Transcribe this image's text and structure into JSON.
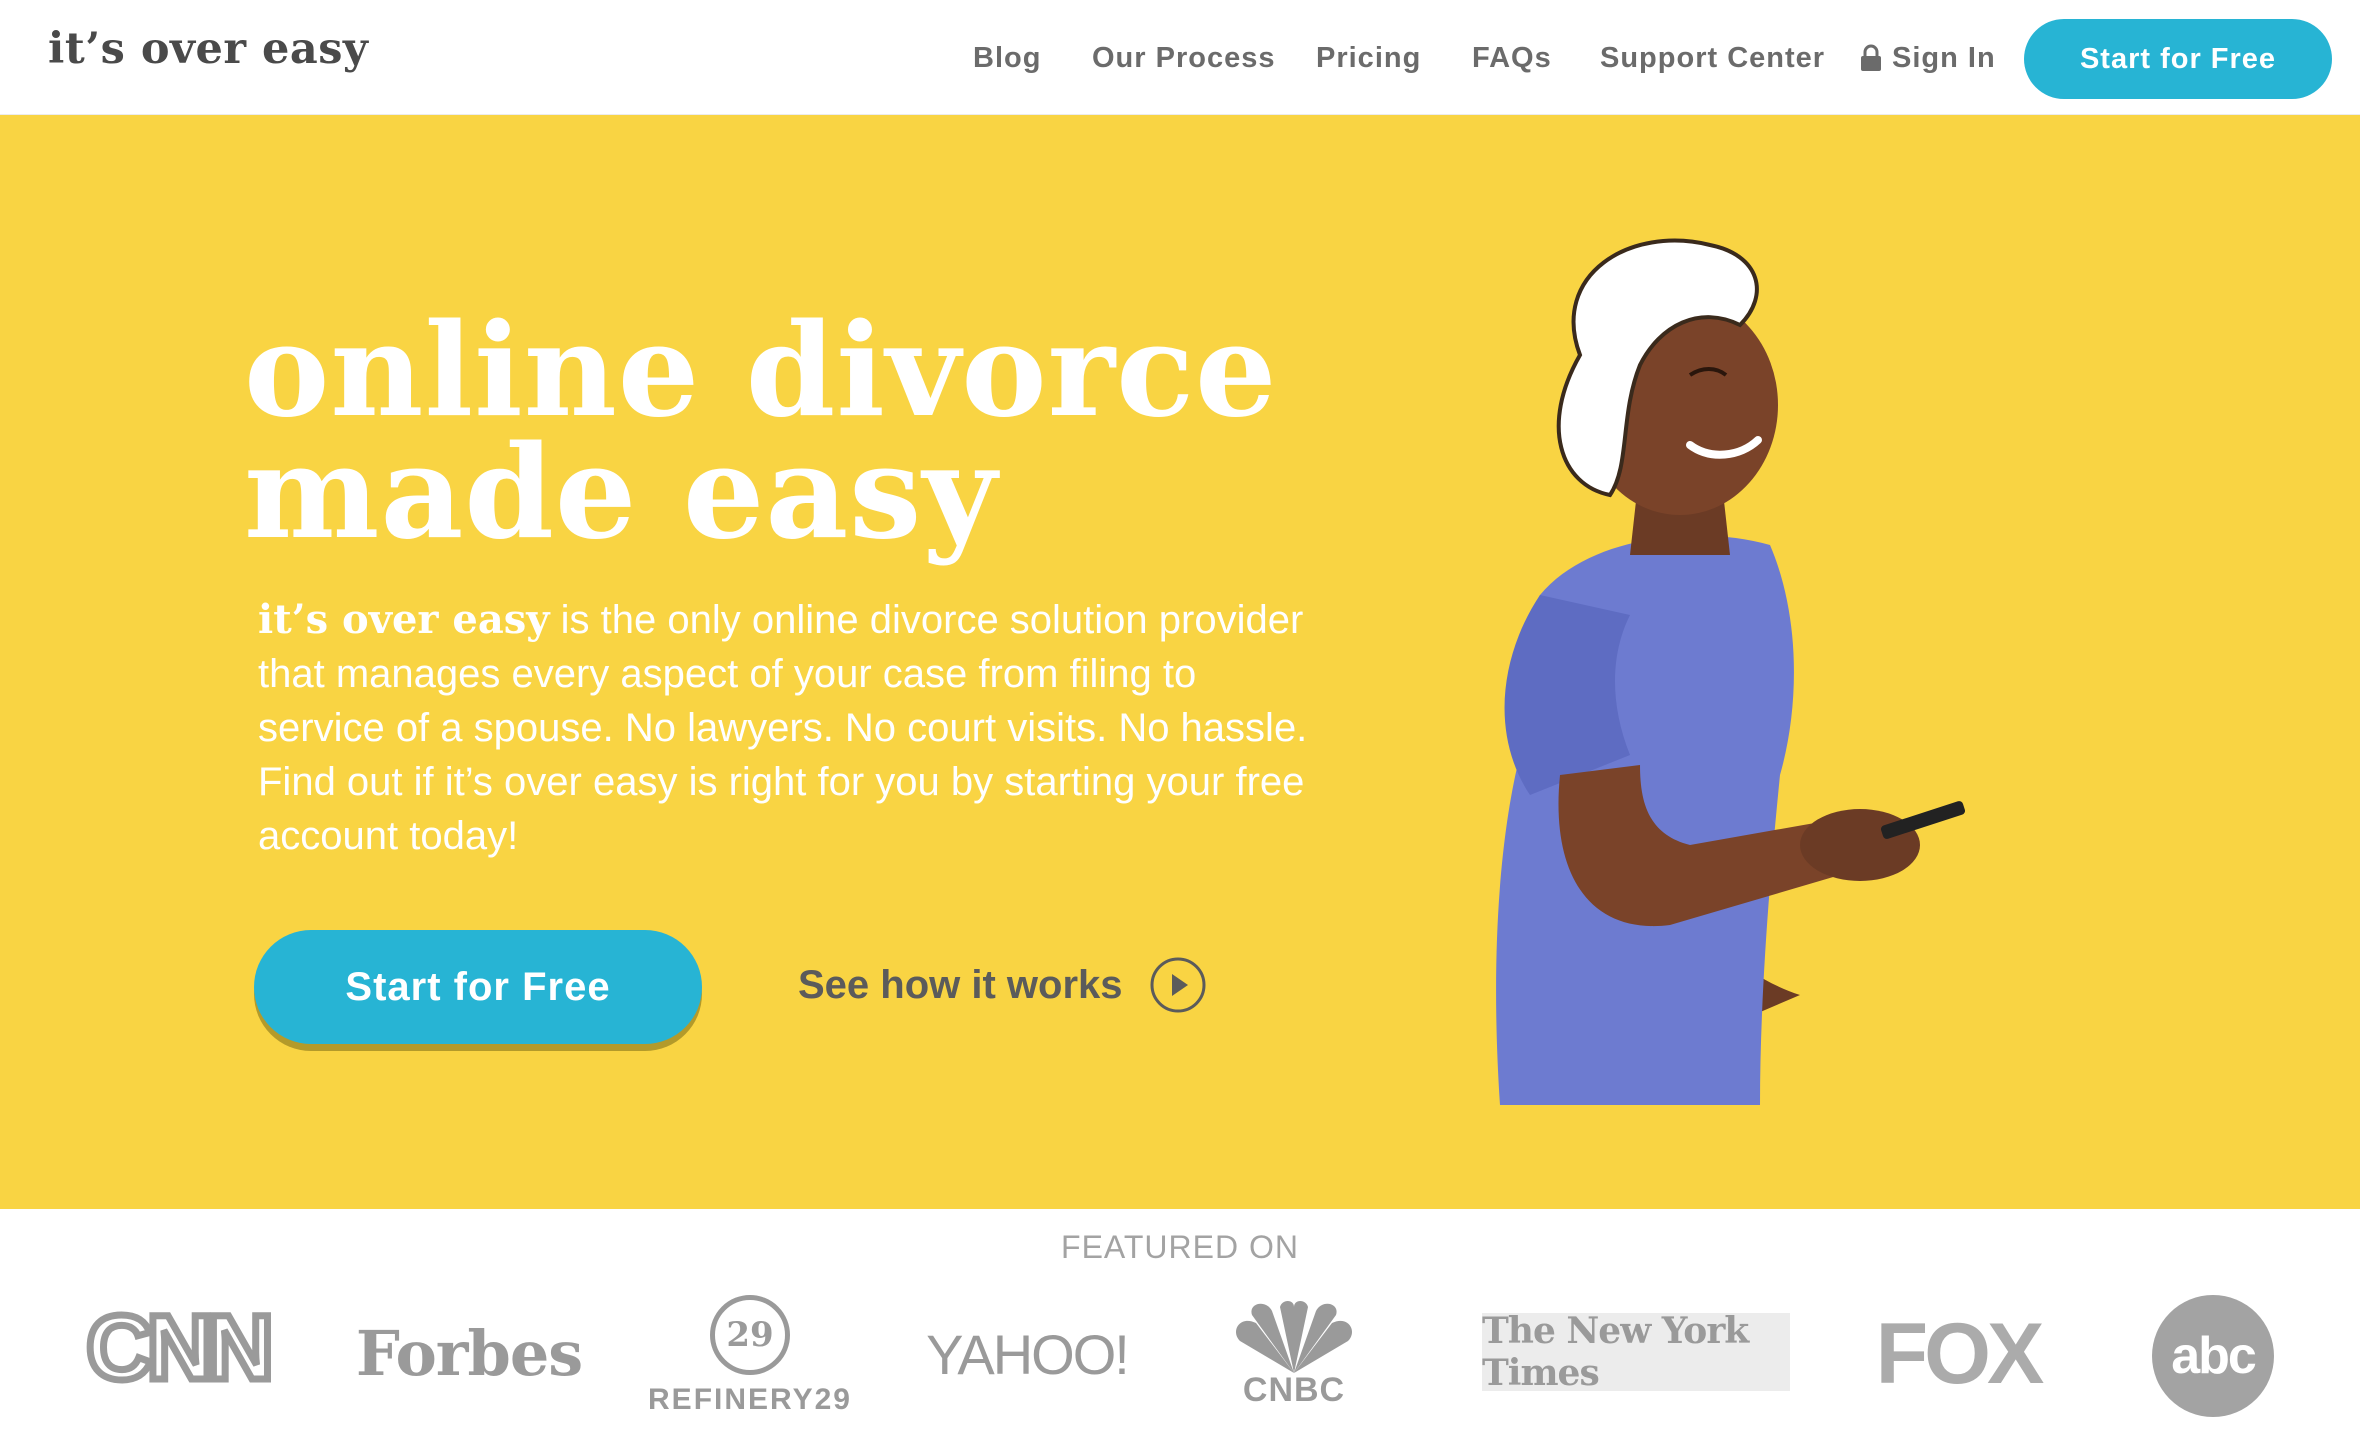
{
  "header": {
    "logo": "it’s over easy",
    "nav": [
      {
        "label": "Blog"
      },
      {
        "label": "Our Process"
      },
      {
        "label": "Pricing"
      },
      {
        "label": "FAQs"
      },
      {
        "label": "Support Center"
      },
      {
        "label": "Sign In",
        "icon": "lock-icon"
      }
    ],
    "cta_label": "Start for Free"
  },
  "hero": {
    "title_line1": "online divorce",
    "title_line2": "made easy",
    "desc_brand": "it’s over easy",
    "desc_text": " is the only online divorce solution provider that manages every aspect of your case from filing to service of a spouse. No lawyers. No court visits. No hassle. Find out if it’s over easy is right for you by starting your free account today!",
    "cta_label": "Start for Free",
    "secondary_label": "See how it works",
    "secondary_icon": "play-circle-icon"
  },
  "featured": {
    "label": "FEATURED ON",
    "logos": {
      "cnn": "CNN",
      "forbes": "Forbes",
      "refinery_mark": "29",
      "refinery": "REFINERY29",
      "yahoo": "YAHOO!",
      "cnbc": "CNBC",
      "nyt": "The New York Times",
      "fox": "FOX",
      "abc": "abc"
    }
  },
  "colors": {
    "hero_bg": "#f9d443",
    "accent": "#27b4d4",
    "nav_text": "#6b6b6b",
    "shirt": "#6d7bd0"
  }
}
